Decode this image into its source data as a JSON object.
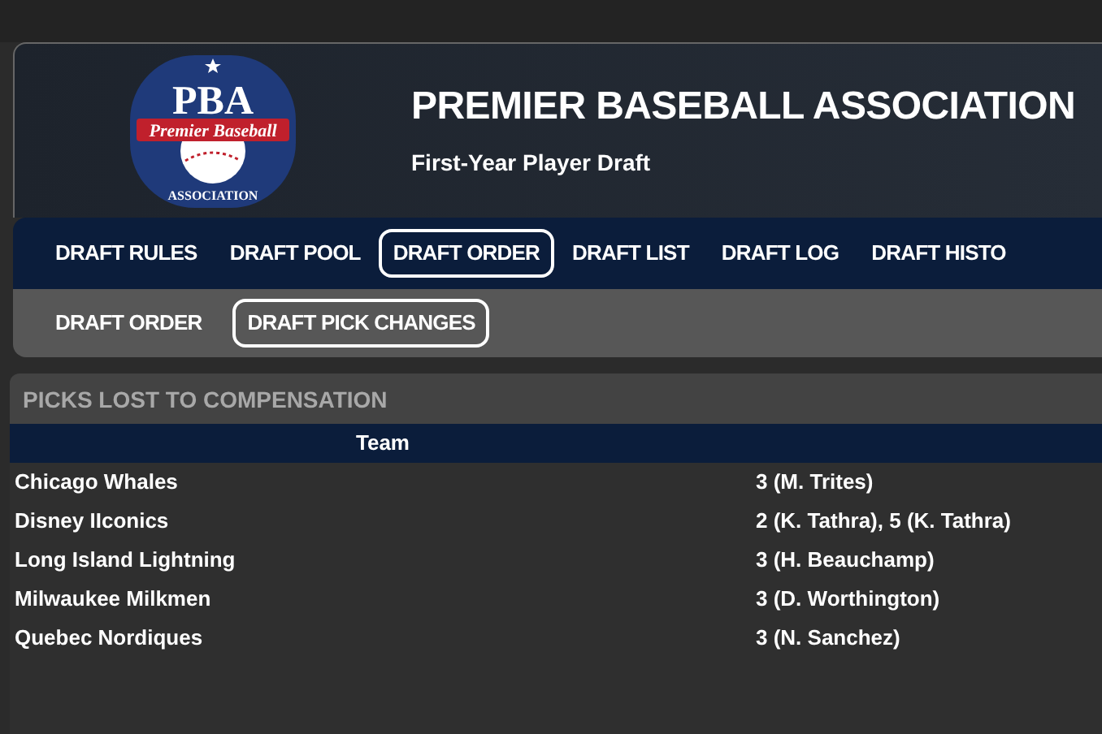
{
  "logo": {
    "initials": "PBA",
    "banner": "Premier Baseball",
    "ring": "ASSOCIATION"
  },
  "header": {
    "title": "PREMIER BASEBALL ASSOCIATION",
    "subtitle": "First-Year Player Draft"
  },
  "tabs": [
    {
      "label": "DRAFT RULES",
      "selected": false
    },
    {
      "label": "DRAFT POOL",
      "selected": false
    },
    {
      "label": "DRAFT ORDER",
      "selected": true
    },
    {
      "label": "DRAFT LIST",
      "selected": false
    },
    {
      "label": "DRAFT LOG",
      "selected": false
    },
    {
      "label": "DRAFT HISTO",
      "selected": false
    }
  ],
  "subtabs": [
    {
      "label": "DRAFT ORDER",
      "selected": false
    },
    {
      "label": "DRAFT PICK CHANGES",
      "selected": true
    }
  ],
  "section": {
    "title": "PICKS LOST TO COMPENSATION",
    "table": {
      "columns": [
        "Team"
      ],
      "rows": [
        [
          "Chicago Whales",
          "3 (M. Trites)"
        ],
        [
          "Disney IIconics",
          "2 (K. Tathra), 5 (K. Tathra)"
        ],
        [
          "Long Island Lightning",
          "3 (H. Beauchamp)"
        ],
        [
          "Milwaukee Milkmen",
          "3 (D. Worthington)"
        ],
        [
          "Quebec Nordiques",
          "3 (N. Sanchez)"
        ]
      ]
    }
  }
}
